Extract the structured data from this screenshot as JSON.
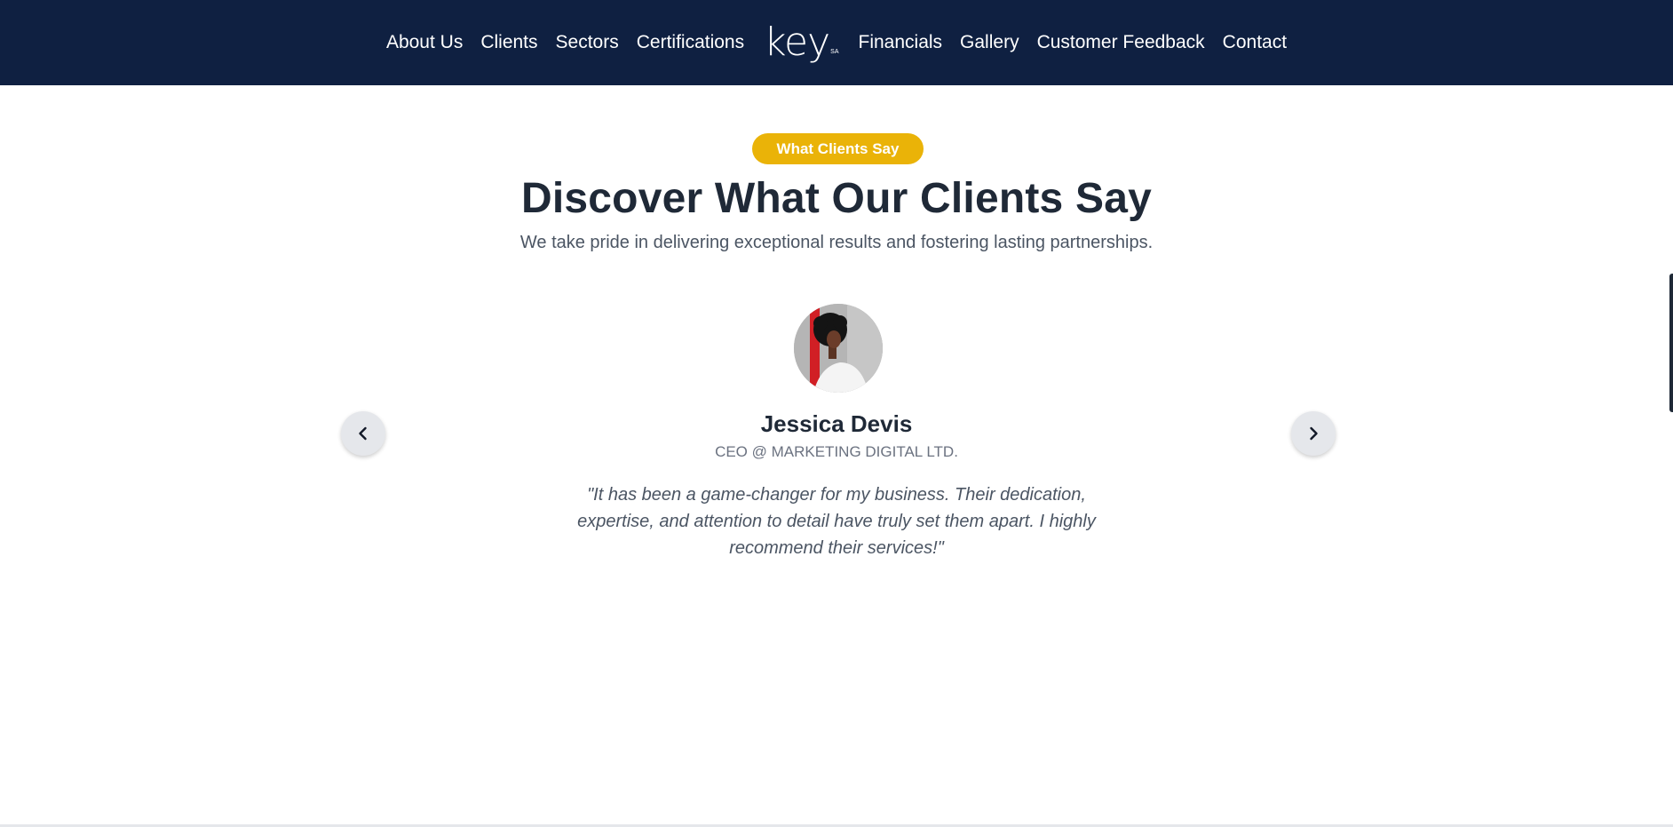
{
  "nav": {
    "left_links": [
      "About Us",
      "Clients",
      "Sectors",
      "Certifications"
    ],
    "right_links": [
      "Financials",
      "Gallery",
      "Customer Feedback",
      "Contact"
    ],
    "logo_text": "key",
    "logo_suffix": "SA"
  },
  "testimonials": {
    "badge": "What Clients Say",
    "title": "Discover What Our Clients Say",
    "subtitle": "We take pride in delivering exceptional results and fostering lasting partnerships.",
    "current": {
      "name": "Jessica Devis",
      "role": "CEO @ MARKETING DIGITAL LTD.",
      "quote": "\"It has been a game-changer for my business. Their dedication, expertise, and attention to detail have truly set them apart. I highly recommend their services!\""
    },
    "prev_icon": "chevron-left-icon",
    "next_icon": "chevron-right-icon"
  },
  "colors": {
    "navbar": "#0f2041",
    "accent": "#eab308",
    "heading": "#1f2937",
    "body_text": "#4b5563"
  }
}
